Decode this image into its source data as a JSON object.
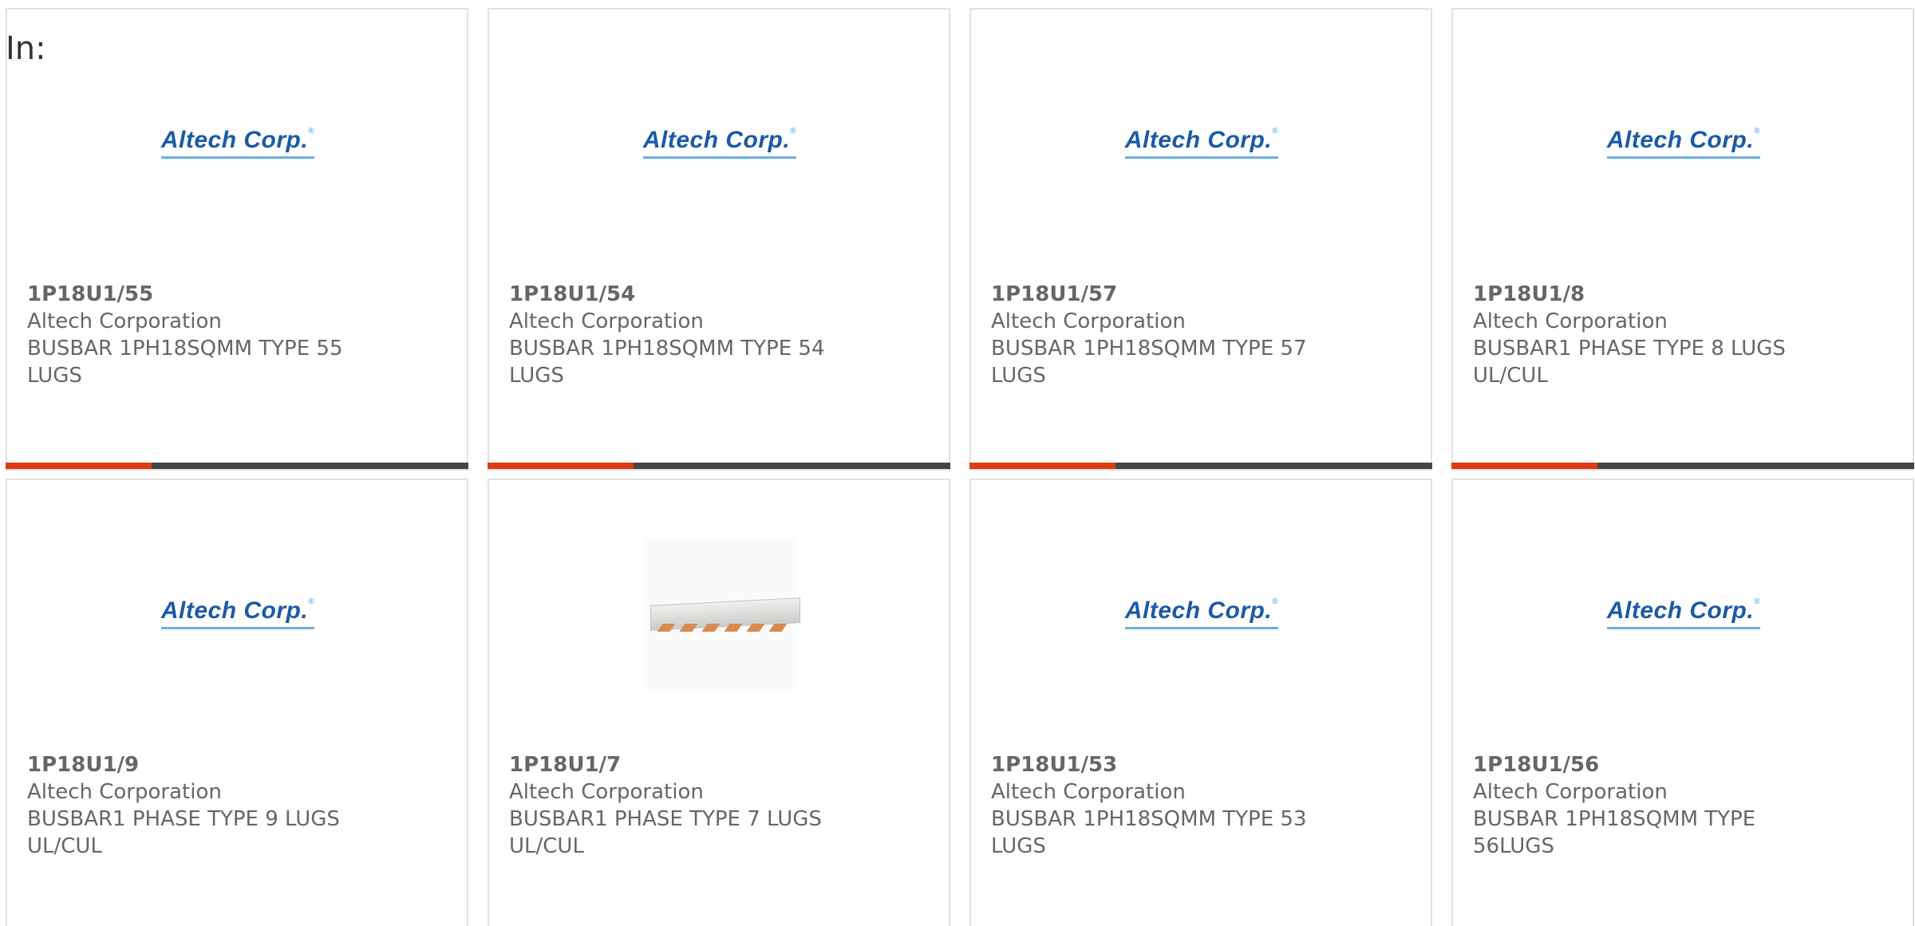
{
  "filter": {
    "label": "In:"
  },
  "colors": {
    "accent": "#e03a12",
    "bar": "#444444",
    "text": "#666666",
    "logo": "#1a5aa6"
  },
  "products": [
    {
      "part_number": "1P18U1/55",
      "manufacturer": "Altech Corporation",
      "description": "BUSBAR 1PH18SQMM TYPE 55 LUGS",
      "image": "altech-logo",
      "logo_text": "Altech Corp.",
      "show_accent": true
    },
    {
      "part_number": "1P18U1/54",
      "manufacturer": "Altech Corporation",
      "description": "BUSBAR 1PH18SQMM TYPE 54 LUGS",
      "image": "altech-logo",
      "logo_text": "Altech Corp.",
      "show_accent": true
    },
    {
      "part_number": "1P18U1/57",
      "manufacturer": "Altech Corporation",
      "description": "BUSBAR 1PH18SQMM TYPE 57 LUGS",
      "image": "altech-logo",
      "logo_text": "Altech Corp.",
      "show_accent": true
    },
    {
      "part_number": "1P18U1/8",
      "manufacturer": "Altech Corporation",
      "description": "BUSBAR1 PHASE TYPE 8 LUGS UL/CUL",
      "image": "altech-logo",
      "logo_text": "Altech Corp.",
      "show_accent": true
    },
    {
      "part_number": "1P18U1/9",
      "manufacturer": "Altech Corporation",
      "description": "BUSBAR1 PHASE TYPE 9 LUGS UL/CUL",
      "image": "altech-logo",
      "logo_text": "Altech Corp.",
      "show_accent": false
    },
    {
      "part_number": "1P18U1/7",
      "manufacturer": "Altech Corporation",
      "description": "BUSBAR1 PHASE TYPE 7 LUGS UL/CUL",
      "image": "busbar-photo",
      "logo_text": "",
      "show_accent": false
    },
    {
      "part_number": "1P18U1/53",
      "manufacturer": "Altech Corporation",
      "description": "BUSBAR 1PH18SQMM TYPE 53 LUGS",
      "image": "altech-logo",
      "logo_text": "Altech Corp.",
      "show_accent": false
    },
    {
      "part_number": "1P18U1/56",
      "manufacturer": "Altech Corporation",
      "description": "BUSBAR 1PH18SQMM TYPE 56LUGS",
      "image": "altech-logo",
      "logo_text": "Altech Corp.",
      "show_accent": false
    }
  ]
}
